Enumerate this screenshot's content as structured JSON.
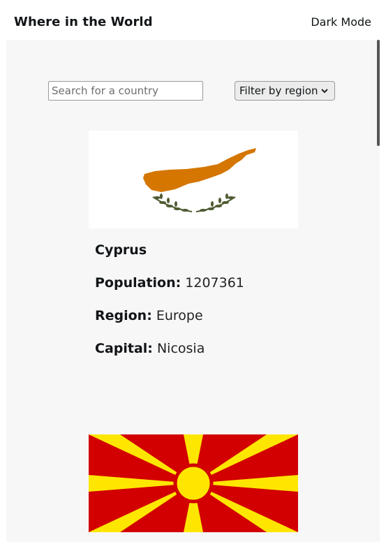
{
  "header": {
    "title": "Where in the World",
    "mode_toggle_label": "Dark Mode"
  },
  "search": {
    "placeholder": "Search for a country",
    "value": ""
  },
  "filter": {
    "label": "Filter by region",
    "icon": "chevron-down-icon"
  },
  "countries": [
    {
      "name": "Cyprus",
      "population_label": "Population:",
      "population": "1207361",
      "region_label": "Region:",
      "region": "Europe",
      "capital_label": "Capital:",
      "capital": "Nicosia",
      "flag_colors": {
        "background": "#ffffff",
        "island": "#d47600",
        "branches": "#4e5b31"
      }
    },
    {
      "flag_colors": {
        "background": "#d20000",
        "rays": "#ffe600"
      }
    }
  ]
}
